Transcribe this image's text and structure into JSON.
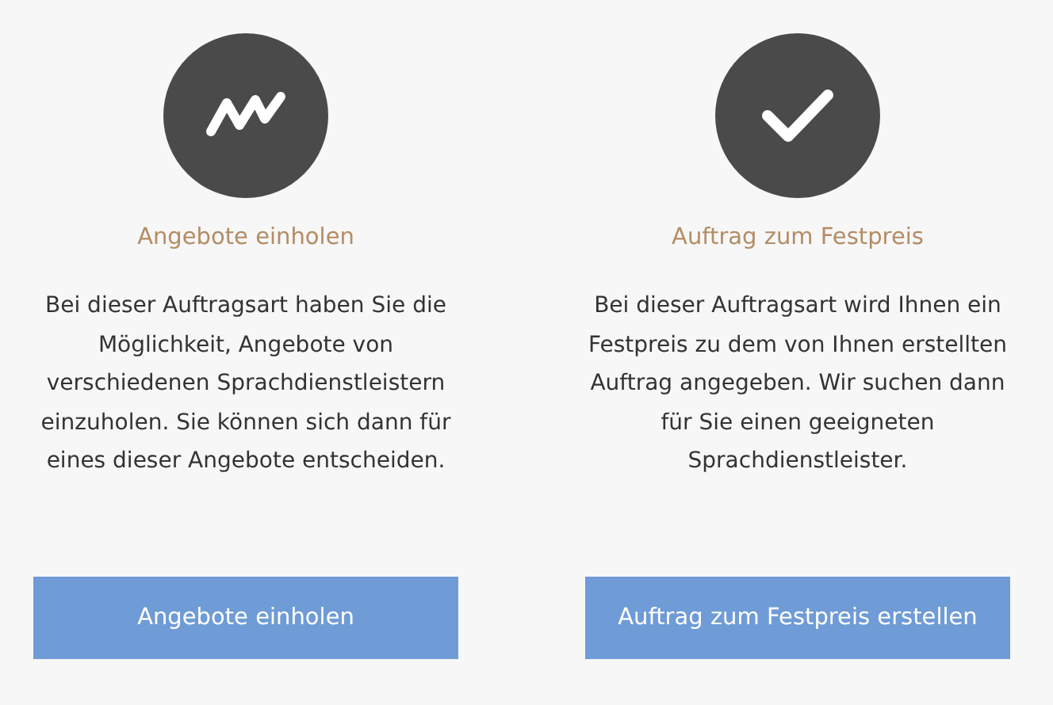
{
  "cards": [
    {
      "kind": "quotes",
      "title": "Angebote einholen",
      "text": "Bei dieser Auftragsart haben Sie die Möglichkeit, Angebote von verschiedenen Sprachdienstleistern einzuholen. Sie können sich dann für eines dieser Angebote entscheiden.",
      "button": "Angebote einholen"
    },
    {
      "kind": "fixed",
      "title": "Auftrag zum Festpreis",
      "text": "Bei dieser Auftragsart wird Ihnen ein Festpreis zu dem von Ihnen erstellten Auftrag angegeben. Wir suchen dann für Sie einen geeigneten Sprachdienstleister.",
      "button": "Auftrag zum Festpreis erstellen"
    }
  ]
}
